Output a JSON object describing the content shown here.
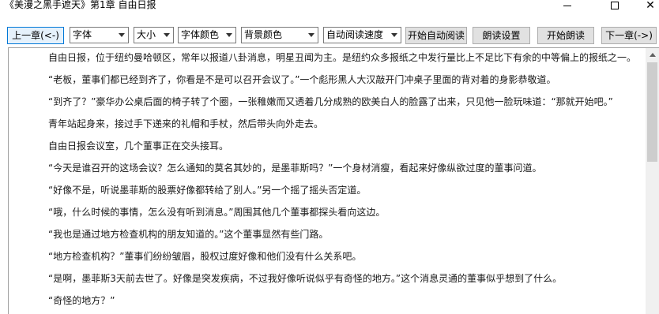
{
  "window": {
    "title": "《美漫之黑手遮天》第1章 自由日报",
    "minimize_icon": "minimize-icon",
    "maximize_icon": "maximize-icon",
    "close_icon": "close-icon"
  },
  "toolbar": {
    "prev_chapter_label": "上一章(<-)",
    "font_select": "字体",
    "size_select": "大小",
    "font_color_select": "字体颜色",
    "bg_color_select": "背景颜色",
    "auto_speed_select": "自动阅读速度",
    "start_auto_read_label": "开始自动阅读",
    "read_aloud_settings_label": "朗读设置",
    "start_read_aloud_label": "开始朗读",
    "next_chapter_label": "下一章(->)"
  },
  "content": {
    "paragraphs": [
      "自由日报，位于纽约曼哈顿区，常年以报道八卦消息，明星丑闻为主。是纽约众多报纸之中发行量比上不足比下有余的中等偏上的报纸之一。",
      "“老板，董事们都已经到齐了，你看是不是可以召开会议了。”一个彪形黑人大汉敲开门冲桌子里面的背对着的身影恭敬道。",
      "“到齐了？”豪华办公桌后面的椅子转了个圈，一张稚嫩而又透着几分成熟的欧美白人的脸露了出来，只见他一脸玩味道：“那就开始吧。”",
      "青年站起身来，接过手下递来的礼帽和手杖，然后带头向外走去。",
      "自由日报会议室，几个董事正在交头接耳。",
      "“今天是谁召开的这场会议？怎么通知的莫名其妙的，是墨菲斯吗？”一个身材消瘦，看起来好像纵欲过度的董事问道。",
      "“好像不是，听说墨菲斯的股票好像都转给了别人。”另一个摇了摇头否定道。",
      "“哦，什么时候的事情，怎么没有听到消息。”周围其他几个董事都探头看向这边。",
      "“我也是通过地方检查机构的朋友知道的。”这个董事显然有些门路。",
      "“地方检查机构？”董事们纷纷皱眉，股权过度好像和他们没有什么关系吧。",
      "“是啊，墨菲斯3天前去世了。好像是突发疾病，不过我好像听说似乎有奇怪的地方。”这个消息灵通的董事似乎想到了什么。",
      "“奇怪的地方？”"
    ]
  }
}
